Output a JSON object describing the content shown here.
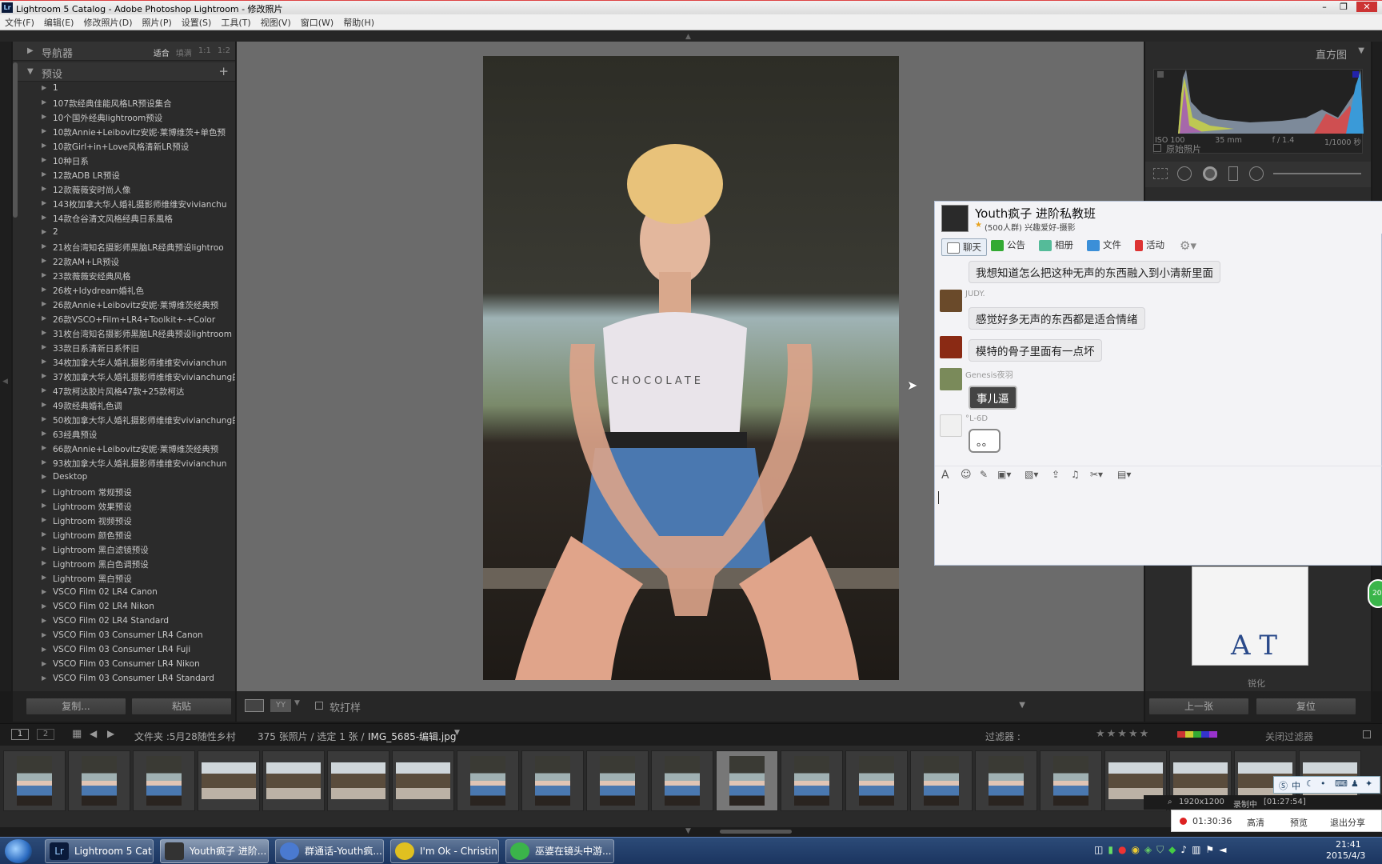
{
  "window": {
    "title": "Lightroom 5 Catalog - Adobe Photoshop Lightroom - 修改照片"
  },
  "menu": [
    "文件(F)",
    "编辑(E)",
    "修改照片(D)",
    "照片(P)",
    "设置(S)",
    "工具(T)",
    "视图(V)",
    "窗口(W)",
    "帮助(H)"
  ],
  "left_panel": {
    "navigator_label": "导航器",
    "nav_options": [
      "适合",
      "填满",
      "1:1",
      "1:2"
    ],
    "presets_label": "预设",
    "presets": [
      "1",
      "107款经典佳能风格LR预设集合",
      "10个国外经典lightroom预设",
      "10款Annie+Leibovitz安妮·莱博维茨+单色预",
      "10款Girl+in+Love风格清新LR预设",
      "10种日系",
      "12款ADB LR预设",
      "12款薇薇安时尚人像",
      "143枚加拿大华人婚礼摄影师维维安vivianchu",
      "14款仓谷清文风格经典日系風格",
      "2",
      "21枚台湾知名摄影师黑脑LR经典预设lightroo",
      "22款AM+LR预设",
      "23款薇薇安经典风格",
      "26枚+Idydream婚礼色",
      "26款Annie+Leibovitz安妮·莱博维茨经典预",
      "26款VSCO+Film+LR4+Toolkit+-+Color",
      "31枚台湾知名摄影师黑脑LR经典预设lightroom",
      "33款日系清新日系怀旧",
      "34枚加拿大华人婚礼摄影师维维安vivianchun",
      "37枚加拿大华人婚礼摄影师维维安vivianchung的3",
      "47款柯达胶片风格47款+25款柯达",
      "49款经典婚礼色调",
      "50枚加拿大华人婚礼摄影师维维安vivianchung的L",
      "63经典预设",
      "66款Annie+Leibovitz安妮·莱博维茨经典预",
      "93枚加拿大华人婚礼摄影师维维安vivianchun",
      "Desktop",
      "Lightroom 常规预设",
      "Lightroom 效果预设",
      "Lightroom 视频预设",
      "Lightroom 颜色预设",
      "Lightroom 黑白滤镜预设",
      "Lightroom 黑白色调预设",
      "Lightroom 黑白预设",
      "VSCO Film 02 LR4 Canon",
      "VSCO Film 02 LR4 Nikon",
      "VSCO Film 02 LR4 Standard",
      "VSCO Film 03 Consumer LR4 Canon",
      "VSCO Film 03 Consumer LR4 Fuji",
      "VSCO Film 03 Consumer LR4 Nikon",
      "VSCO Film 03 Consumer LR4 Standard"
    ],
    "copy_label": "复制...",
    "paste_label": "粘贴"
  },
  "center": {
    "soft_proof_label": "软打样",
    "shirt_text": "CHOCOLATE"
  },
  "right_panel": {
    "histogram_label": "直方图",
    "iso": "ISO 100",
    "focal": "35 mm",
    "aperture": "f / 1.4",
    "shutter": "1/1000 秒",
    "original_label": "原始照片",
    "bottom_label": "锐化",
    "prev_label": "上一张",
    "reset_label": "复位"
  },
  "filmstrip": {
    "page1": "1",
    "page2": "2",
    "source": "文件夹 :5月28随性乡村",
    "count": "375 张照片 / 选定 1 张 /",
    "filename": "IMG_5685-编辑.jpg",
    "filter_label": "过滤器 :",
    "filter_off": "关闭过滤器"
  },
  "chat": {
    "group_name": "Youth疯子 进阶私教班",
    "group_meta": "(500人群) 兴趣爱好-摄影",
    "tabs": [
      "聊天",
      "公告",
      "相册",
      "文件",
      "活动"
    ],
    "messages": [
      {
        "name": "",
        "text": "我想知道怎么把这种无声的东西融入到小清新里面"
      },
      {
        "name": "JUDY.",
        "text": "感觉好多无声的东西都是适合情绪"
      },
      {
        "name": "",
        "text": "模特的骨子里面有一点坏"
      },
      {
        "name": "Genesis夜羽",
        "text": "事儿逼"
      },
      {
        "name": "°L-6D",
        "text": "。。"
      }
    ]
  },
  "recorder": {
    "time": "01:30:36",
    "hd": "高清",
    "preview": "预览",
    "exit": "退出分享",
    "res": "1920x1200",
    "rec": "录制中",
    "rec_time": "[01:27:54]"
  },
  "taskbar": {
    "tasks": [
      "Lightroom 5 Cat...",
      "Youth疯子 进阶...",
      "群通话-Youth疯...",
      "I'm Ok - Christin...",
      "巫婆在镜头中游..."
    ],
    "time": "21:41",
    "date": "2015/4/3"
  },
  "ime": {
    "lang": "中"
  },
  "colors": {
    "accent": "#d44444",
    "lr_bg": "#2b2b2b",
    "taskbar": "#1b3560"
  }
}
